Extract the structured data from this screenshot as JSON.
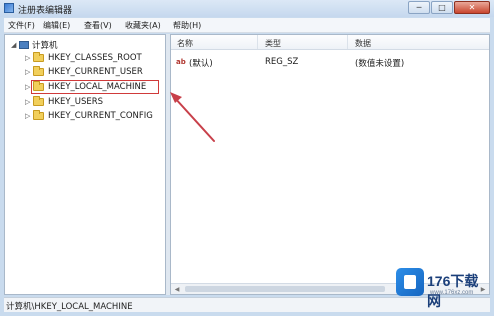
{
  "window": {
    "title": "注册表编辑器",
    "minimize": "─",
    "maximize": "□",
    "close": "✕"
  },
  "menu": [
    "文件(F)",
    "编辑(E)",
    "查看(V)",
    "收藏夹(A)",
    "帮助(H)"
  ],
  "tree": {
    "root": {
      "expander": "◢",
      "label": "计算机"
    },
    "items": [
      {
        "expander": "▷",
        "label": "HKEY_CLASSES_ROOT"
      },
      {
        "expander": "▷",
        "label": "HKEY_CURRENT_USER"
      },
      {
        "expander": "▷",
        "label": "HKEY_LOCAL_MACHINE"
      },
      {
        "expander": "▷",
        "label": "HKEY_USERS"
      },
      {
        "expander": "▷",
        "label": "HKEY_CURRENT_CONFIG"
      }
    ]
  },
  "list": {
    "columns": [
      "名称",
      "类型",
      "数据"
    ],
    "rows": [
      {
        "icon": "ab",
        "name": "(默认)",
        "type": "REG_SZ",
        "data": "(数值未设置)"
      }
    ],
    "scroll_left": "◀",
    "scroll_right": "▶"
  },
  "status": {
    "path": "计算机\\HKEY_LOCAL_MACHINE"
  },
  "watermark": {
    "brand": "176下载网",
    "url": "www.176xz.com"
  },
  "colors": {
    "highlight_box": "#d03a3a",
    "arrow": "#c8404a",
    "frame": "#c9dbee"
  }
}
